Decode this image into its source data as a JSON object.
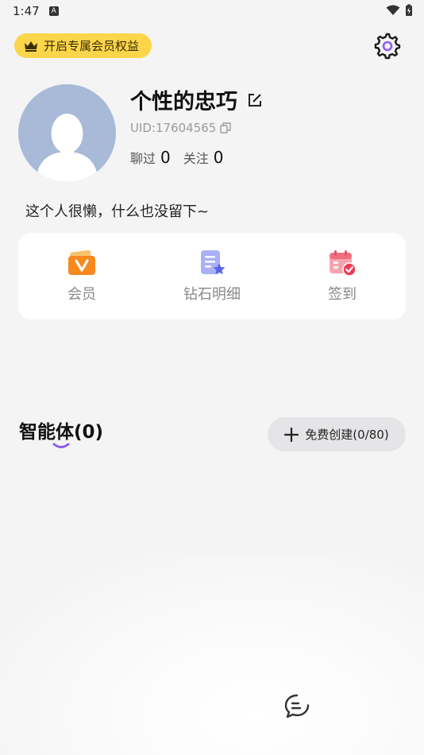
{
  "status": {
    "time": "1:47",
    "notif_letter": "A"
  },
  "vip": {
    "label": "开启专属会员权益"
  },
  "profile": {
    "name": "个性的忠巧",
    "uid": "UID:17604565",
    "chatted_label": "聊过",
    "chatted_count": "0",
    "following_label": "关注",
    "following_count": "0",
    "bio": "这个人很懒，什么也没留下~"
  },
  "shortcuts": [
    {
      "label": "会员",
      "icon": "vip-icon"
    },
    {
      "label": "钻石明细",
      "icon": "diamond-detail-icon"
    },
    {
      "label": "签到",
      "icon": "calendar-checkin-icon"
    }
  ],
  "agents": {
    "title": "智能体(0)",
    "create_label": "免费创建(0/80)"
  },
  "colors": {
    "background": "#f4f4f5",
    "vip_badge": "#fcd64a",
    "accent_purple": "#8b5cf6",
    "avatar_bg": "#a8bad8"
  }
}
